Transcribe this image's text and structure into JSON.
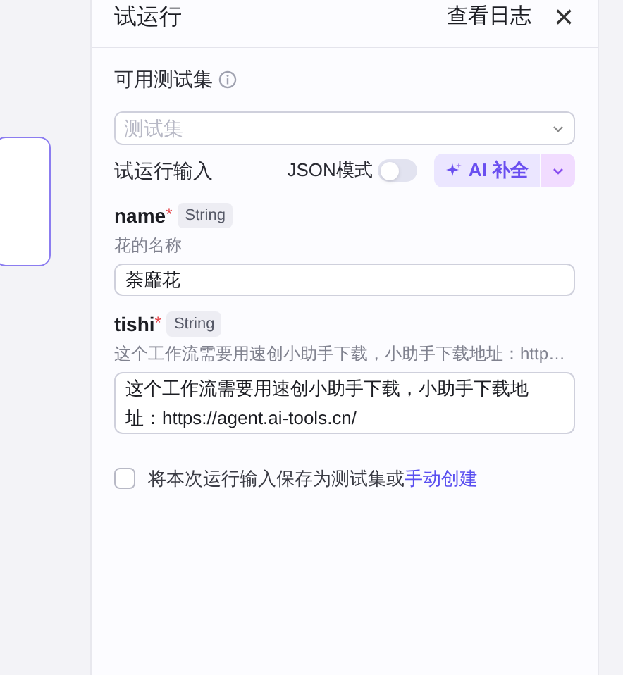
{
  "panel": {
    "title": "试运行",
    "log_link": "查看日志",
    "close": "×"
  },
  "test_set": {
    "label": "可用测试集",
    "placeholder": "测试集"
  },
  "run_input": {
    "label": "试运行输入",
    "json_mode_label": "JSON模式",
    "json_mode_on": false,
    "ai_button": "AI 补全"
  },
  "fields": [
    {
      "name": "name",
      "required_mark": "*",
      "type": "String",
      "description": "花的名称",
      "value": "荼靡花"
    },
    {
      "name": "tishi",
      "required_mark": "*",
      "type": "String",
      "description": "这个工作流需要用速创小助手下载，小助手下载地址：http…",
      "value": "这个工作流需要用速创小助手下载，小助手下载地址：https://agent.ai-tools.cn/"
    }
  ],
  "save_option": {
    "checked": false,
    "text": "将本次运行输入保存为测试集或",
    "link": "手动创建"
  }
}
